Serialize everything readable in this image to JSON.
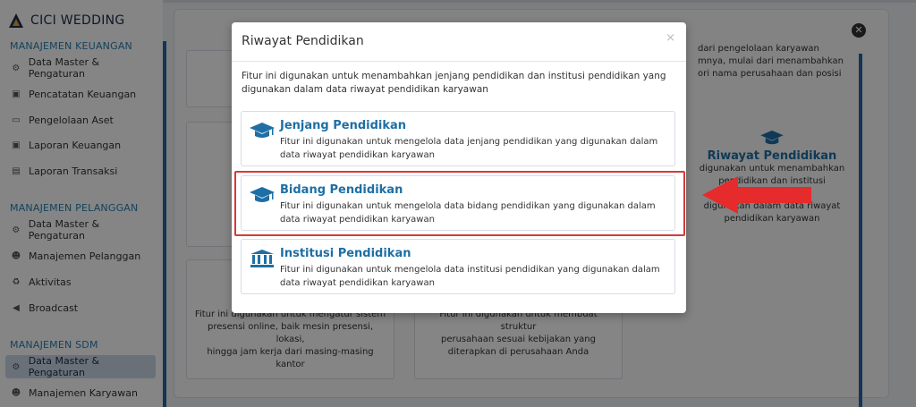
{
  "sidebar": {
    "brand": "CICI WEDDING",
    "sections": [
      {
        "title": "MANAJEMEN KEUANGAN",
        "items": [
          "Data Master & Pengaturan",
          "Pencatatan Keuangan",
          "Pengelolaan Aset",
          "Laporan Keuangan",
          "Laporan Transaksi"
        ]
      },
      {
        "title": "MANAJEMEN PELANGGAN",
        "items": [
          "Data Master & Pengaturan",
          "Manajemen Pelanggan",
          "Aktivitas",
          "Broadcast"
        ]
      },
      {
        "title": "MANAJEMEN SDM",
        "items": [
          "Data Master & Pengaturan",
          "Manajemen Karyawan"
        ]
      }
    ]
  },
  "background": {
    "right_card": {
      "title": "Riwayat Pendidikan",
      "line1": "digunakan untuk menambahkan",
      "line2": "pendidikan dan institusi pendidikan",
      "line3": "digunakan dalam data riwayat",
      "line4": "pendidikan karyawan"
    },
    "left_card": {
      "line1": "Fitur ini digunakan untuk mengatur sistem",
      "line2": "presensi online, baik mesin presensi, lokasi,",
      "line3": "hingga jam kerja dari masing-masing",
      "line4": "kantor"
    },
    "mid_card": {
      "line1": "Fitur ini digunakan untuk membuat struktur",
      "line2": "perusahaan sesuai kebijakan yang",
      "line3": "diterapkan di perusahaan Anda"
    },
    "top_right_partial": {
      "line1": "dari pengelolaan karyawan",
      "line2": "mnya, mulai dari menambahkan",
      "line3": "ori nama perusahaan dan posisi"
    }
  },
  "modal": {
    "title": "Riwayat Pendidikan",
    "close": "×",
    "description": "Fitur ini digunakan untuk menambahkan jenjang pendidikan dan institusi pendidikan yang digunakan dalam data riwayat pendidikan karyawan",
    "options": [
      {
        "title": "Jenjang Pendidikan",
        "icon": "graduation-cap-icon",
        "desc": "Fitur ini digunakan untuk mengelola data jenjang pendidikan yang digunakan dalam data riwayat pendidikan karyawan"
      },
      {
        "title": "Bidang Pendidikan",
        "icon": "graduation-cap-icon",
        "desc": "Fitur ini digunakan untuk mengelola data bidang pendidikan yang digunakan dalam data riwayat pendidikan karyawan"
      },
      {
        "title": "Institusi Pendidikan",
        "icon": "institution-icon",
        "desc": "Fitur ini digunakan untuk mengelola data institusi pendidikan yang digunakan dalam data riwayat pendidikan karyawan"
      }
    ]
  },
  "colors": {
    "accent": "#1d6fa5",
    "highlight": "#d63a3a",
    "sidebar_active": "#c9d6e6"
  }
}
